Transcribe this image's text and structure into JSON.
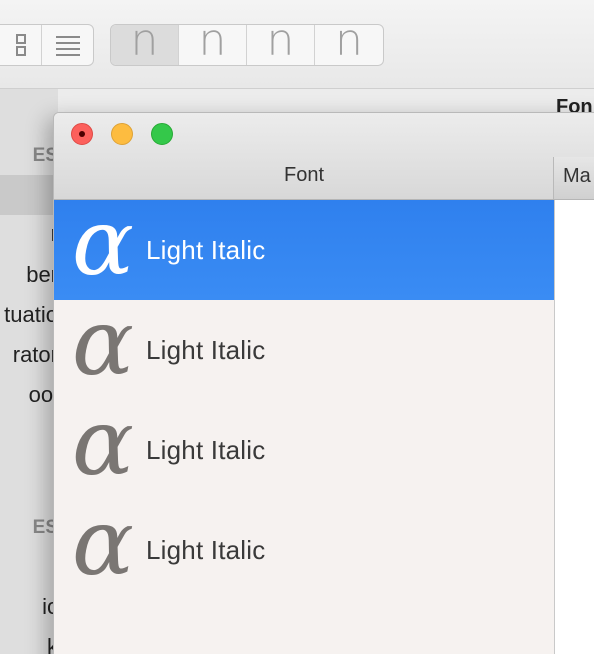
{
  "background_app": {
    "toolbar": {
      "view_buttons": [
        {
          "icon": "grid-view-icon"
        },
        {
          "icon": "list-view-icon"
        }
      ],
      "glyph_buttons": [
        "n",
        "n",
        "n",
        "n"
      ]
    },
    "right_label": "Fon",
    "sidebar": {
      "header_1": "ES",
      "items": [
        "r",
        "ber",
        "tuatio",
        "rator",
        "ool"
      ],
      "header_2": "ES",
      "items_2": [
        "ic",
        "k"
      ]
    }
  },
  "font_window": {
    "window_controls": [
      "close",
      "minimize",
      "zoom"
    ],
    "columns": {
      "font": "Font",
      "ma": "Ma"
    },
    "list": [
      {
        "glyph": "α",
        "label": "Light Italic",
        "selected": true
      },
      {
        "glyph": "α",
        "label": "Light Italic",
        "selected": false
      },
      {
        "glyph": "α",
        "label": "Light Italic",
        "selected": false
      },
      {
        "glyph": "α",
        "label": "Light Italic",
        "selected": false
      }
    ]
  },
  "colors": {
    "selection": "#2f80ee",
    "close": "#fc605c",
    "minimize": "#fdbc40",
    "zoom": "#34c84a"
  }
}
